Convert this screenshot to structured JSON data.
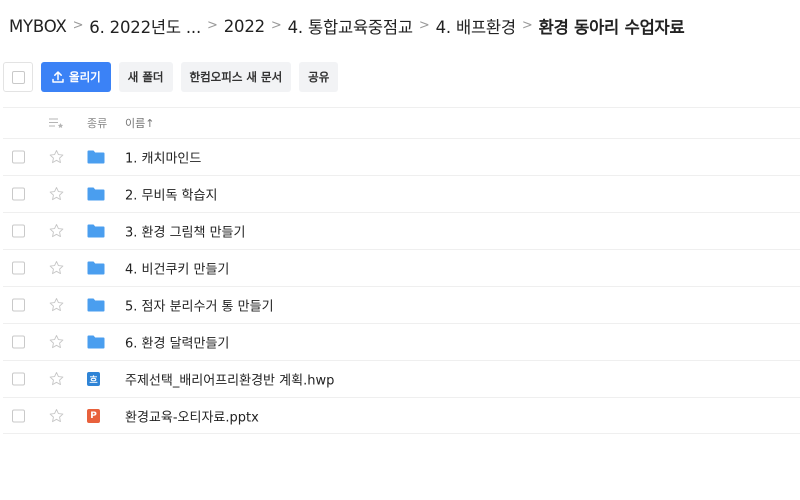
{
  "breadcrumb": [
    {
      "label": "MYBOX"
    },
    {
      "label": "6. 2022년도 ..."
    },
    {
      "label": "2022"
    },
    {
      "label": "4. 통합교육중점교"
    },
    {
      "label": "4. 배프환경"
    },
    {
      "label": "환경 동아리 수업자료"
    }
  ],
  "toolbar": {
    "upload_label": "올리기",
    "new_folder_label": "새 폴더",
    "new_doc_label": "한컴오피스 새 문서",
    "share_label": "공유"
  },
  "table": {
    "headers": {
      "kind": "종류",
      "name": "이름↑"
    },
    "rows": [
      {
        "name": "1. 캐치마인드",
        "type": "folder"
      },
      {
        "name": "2. 무비독 학습지",
        "type": "folder"
      },
      {
        "name": "3. 환경 그림책 만들기",
        "type": "folder"
      },
      {
        "name": "4. 비건쿠키 만들기",
        "type": "folder"
      },
      {
        "name": "5. 점자 분리수거 통 만들기",
        "type": "folder"
      },
      {
        "name": "6. 환경 달력만들기",
        "type": "folder"
      },
      {
        "name": "주제선택_배리어프리환경반 계획.hwp",
        "type": "hwp",
        "badge": "흐"
      },
      {
        "name": "환경교육-오티자료.pptx",
        "type": "pptx",
        "badge": "P"
      }
    ]
  },
  "colors": {
    "primary": "#3b82f6",
    "folder": "#4a9eef",
    "hwp": "#2f84d6",
    "pptx": "#e8613c"
  }
}
